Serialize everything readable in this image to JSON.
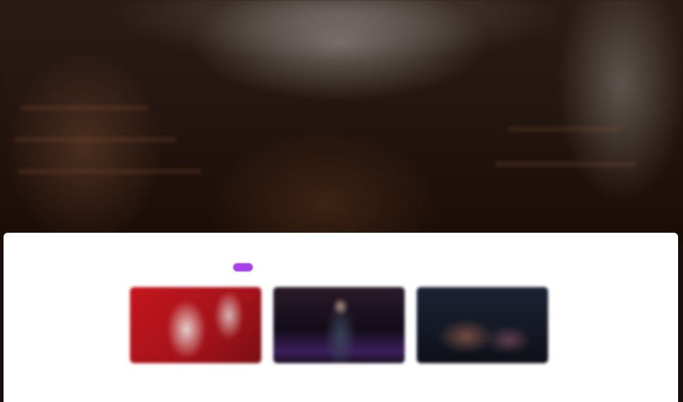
{
  "hero": {
    "title": "",
    "background": "library-interior-image"
  },
  "tabs": [
    {
      "label": "",
      "active": true
    },
    {
      "label": "",
      "active": false
    },
    {
      "label": "",
      "active": false
    },
    {
      "label": "",
      "active": false
    }
  ],
  "cards": [
    {
      "thumbnail": "red-stage-performers-image",
      "meta": "",
      "title": ""
    },
    {
      "thumbnail": "man-in-suit-on-stage-image",
      "meta": "",
      "title": ""
    },
    {
      "thumbnail": "dark-audience-image",
      "meta": "",
      "title": ""
    }
  ],
  "colors": {
    "accent": "#a642e8",
    "panel": "#ffffff",
    "hero_dark": "#22140e"
  }
}
